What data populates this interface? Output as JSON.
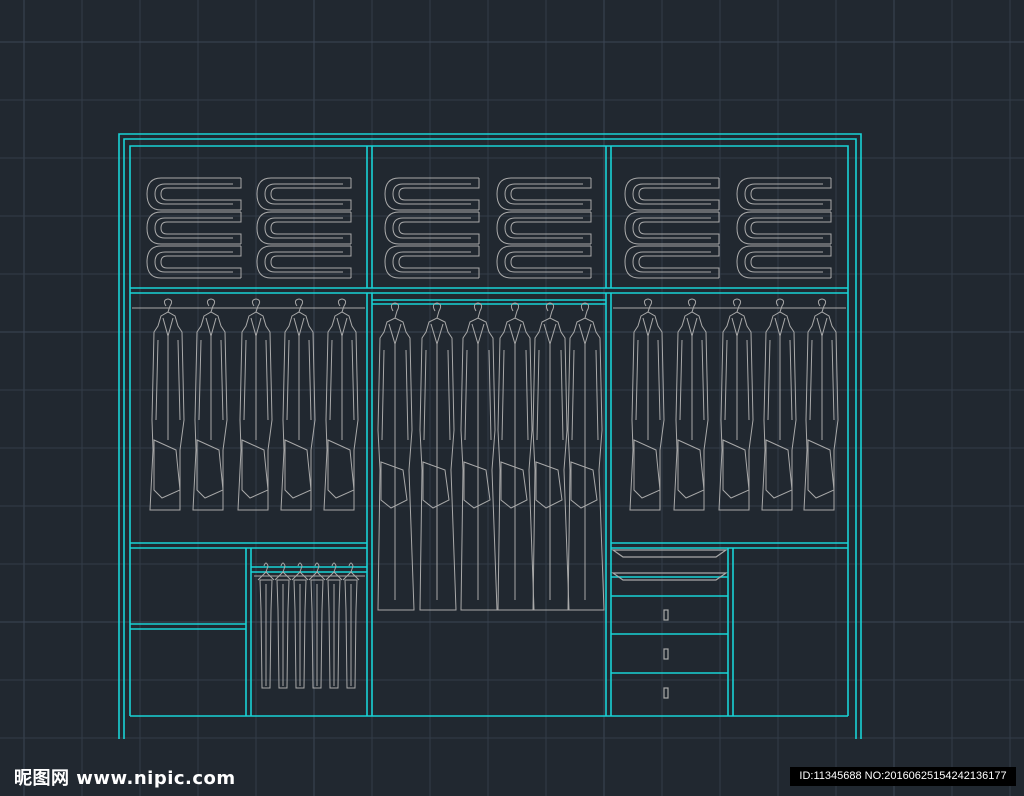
{
  "canvas": {
    "background_color": "#212830",
    "grid_color": "#333c48",
    "grid_color_major": "#3c4654",
    "grid": true
  },
  "drawing": {
    "subject": "wardrobe elevation",
    "frame_color": "#19d3d6",
    "content_color": "#a9a9a9"
  },
  "watermark": {
    "logo": "昵图网 www.nipic.com",
    "id_text": "ID:11345688 NO:20160625154242136177"
  }
}
